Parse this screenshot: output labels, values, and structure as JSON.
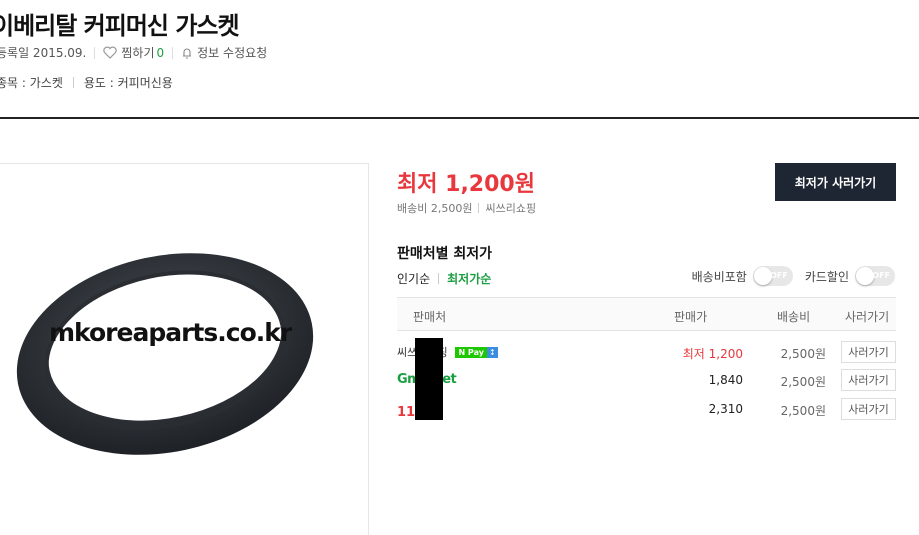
{
  "product": {
    "title": "이베리탈 커피머신 가스켓",
    "registered": "등록일 2015.09.",
    "wishlist_label": "찜하기",
    "wishlist_count": "0",
    "report_label": "정보 수정요청",
    "spec_category": "종목 : 가스켓",
    "spec_usage": "용도 : 커피머신용"
  },
  "image": {
    "watermark": "mkoreaparts.co.kr"
  },
  "offer": {
    "lowest_price": "최저 1,200원",
    "shipping": "배송비 2,500원",
    "shop": "씨쓰리쇼핑",
    "buy_button": "최저가 사러가기"
  },
  "sellers_section": {
    "title": "판매처별 최저가",
    "sort_popular": "인기순",
    "sort_lowest": "최저가순",
    "toggle_shipping": "배송비포함",
    "toggle_card": "카드할인",
    "toggle_off": "OFF",
    "headers": {
      "seller": "판매처",
      "price": "판매가",
      "shipping": "배송비",
      "go": "사러가기"
    },
    "rows": [
      {
        "seller": "씨쓰리쇼핑",
        "badge": "N Pay",
        "price": "최저 1,200",
        "shipping": "2,500원",
        "go": "사러가기"
      },
      {
        "seller": "Gmarket",
        "price": "1,840",
        "shipping": "2,500원",
        "go": "사러가기"
      },
      {
        "seller": "11번가",
        "price": "2,310",
        "shipping": "2,500원",
        "go": "사러가기"
      }
    ]
  },
  "colors": {
    "price_red": "#e8383d",
    "accent_green": "#1a9e42",
    "button_dark": "#1e2633"
  }
}
